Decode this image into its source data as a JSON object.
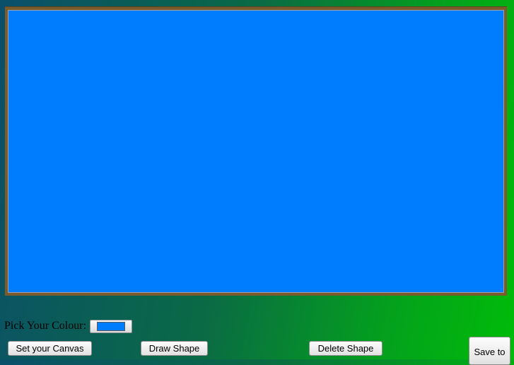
{
  "canvas": {
    "background_color": "#007cff",
    "frame_color": "#7b5a2c"
  },
  "controls": {
    "color_label": "Pick Your Colour:",
    "color_value": "#007cff"
  },
  "buttons": {
    "set_canvas_label": "Set your Canvas",
    "draw_shape_label": "Draw Shape",
    "delete_shape_label": "Delete Shape",
    "save_label": "Save to"
  }
}
